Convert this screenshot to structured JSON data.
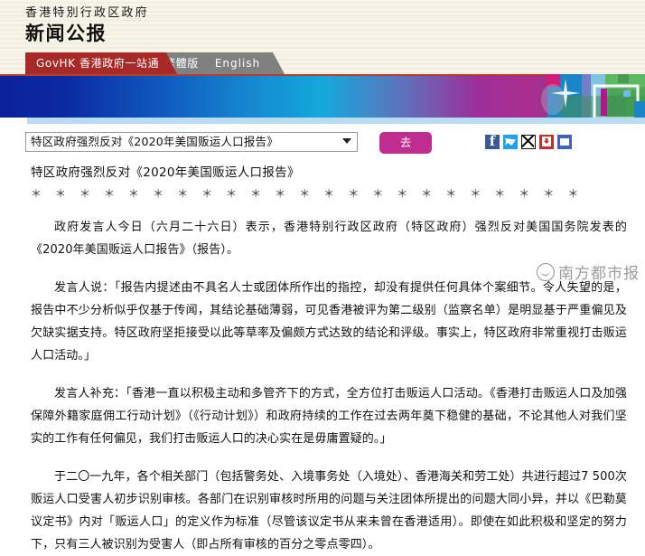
{
  "masthead": {
    "org_name": "香港特別行政区政府",
    "publication": "新闻公报"
  },
  "nav": {
    "gov_tab": "GovHK 香港政府一站通",
    "lang_traditional": "繁體版",
    "lang_english": "English"
  },
  "controls": {
    "select_value": "特区政府强烈反对《2020年美国贩运人口报告》",
    "go_label": "去",
    "socials": [
      {
        "name": "facebook-share-icon",
        "label": "Facebook"
      },
      {
        "name": "twitter-share-icon",
        "label": "Twitter"
      },
      {
        "name": "email-share-icon",
        "label": "Email"
      },
      {
        "name": "download-icon",
        "label": "Download"
      },
      {
        "name": "print-icon",
        "label": "Print"
      }
    ]
  },
  "article": {
    "title": "特区政府强烈反对《2020年美国贩运人口报告》",
    "separator": "＊ ＊ ＊ ＊ ＊ ＊ ＊ ＊ ＊ ＊ ＊ ＊ ＊ ＊ ＊ ＊ ＊ ＊ ＊ ＊ ＊ ＊ ＊",
    "paragraphs": [
      "政府发言人今日（六月二十六日）表示，香港特别行政区政府（特区政府）强烈反对美国国务院发表的《2020年美国贩运人口报告》（报告）。",
      "发言人说：「报告内提述由不具名人士或团体所作出的指控，却没有提供任何具体个案细节。令人失望的是，报告中不少分析似乎仅基于传闻，其结论基础薄弱，可见香港被评为第二级别（监察名单）是明显基于严重偏见及欠缺实据支持。特区政府坚拒接受以此等草率及偏颇方式达致的结论和评级。事实上，特区政府非常重视打击贩运人口活动。」",
      "发言人补充：「香港一直以积极主动和多管齐下的方式，全方位打击贩运人口活动。《香港打击贩运人口及加强保障外籍家庭佣工行动计划》（《行动计划》）和政府持续的工作在过去两年奠下稳健的基础，不论其他人对我们坚实的工作有任何偏见，我们打击贩运人口的决心实在是毋庸置疑的。」",
      "于二〇一九年，各个相关部门（包括警务处、入境事务处（入境处）、香港海关和劳工处）共进行超过7 500次贩运人口受害人初步识别审核。各部门在识别审核时所用的问题与关注团体所提出的问题大同小异，并以《巴勒莫议定书》内对「贩运人口」的定义作为标准（尽管该议定书从来未曾在香港适用）。即使在如此积极和坚定的努力下，只有三人被识别为受害人（即占所有审核的百分之零点零四）。"
    ]
  },
  "watermark": {
    "text": "南方都市报"
  },
  "colors": {
    "gov_tab_red": "#a72a28",
    "lang_tab_grey": "#808080",
    "go_button_magenta": "#bf2e8f",
    "banner_blue": "#0b219c",
    "banner_magenta": "#ab2e8e",
    "light_strip": "#b7dcf4",
    "masthead_cream": "#f7f4e8"
  }
}
